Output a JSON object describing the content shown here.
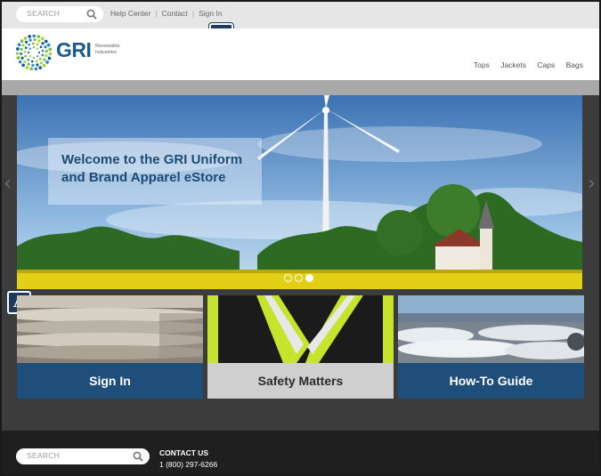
{
  "topbar": {
    "search_placeholder": "SEARCH",
    "links": [
      "Help Center",
      "Contact",
      "Sign In"
    ],
    "badge": "A"
  },
  "header": {
    "logo_text": "GRI",
    "logo_sub": "Renewable Industries",
    "nav": [
      "Tops",
      "Jackets",
      "Caps",
      "Bags"
    ]
  },
  "hero": {
    "caption": "Welcome to the GRI Uniform and Brand Apparel eStore",
    "slides": 3,
    "active_slide": 3,
    "prev_icon": "chevron-left-icon",
    "next_icon": "chevron-right-icon"
  },
  "tiles": [
    {
      "label": "Sign In"
    },
    {
      "label": "Safety Matters"
    },
    {
      "label": "How-To Guide"
    }
  ],
  "side_badge": "A",
  "footer": {
    "search_placeholder": "SEARCH",
    "contact_title": "CONTACT US",
    "contact_phone": "1 (800) 297-6266"
  },
  "colors": {
    "brand_blue": "#1f4e7a",
    "logo_blue": "#1a5a8e",
    "footer_bg": "#1f1f1f"
  }
}
